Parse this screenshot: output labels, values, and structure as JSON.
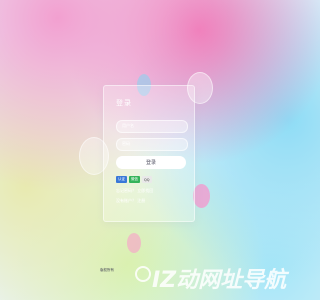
{
  "login": {
    "title": "登录",
    "username_placeholder": "用户名",
    "password_placeholder": "密码",
    "submit_label": "登录",
    "badges": [
      "认证",
      "微信",
      "QQ"
    ],
    "forgot_link": "忘记密码？ 立即找回",
    "register_link": "没有账户？ 注册"
  },
  "footer": {
    "label": "版权所有"
  },
  "watermark": {
    "text": "IZ动网址导航"
  },
  "colors": {
    "badge_auth": "#3a78d8",
    "badge_wechat": "#33b35a",
    "badge_qq": "#e9e9e9"
  }
}
